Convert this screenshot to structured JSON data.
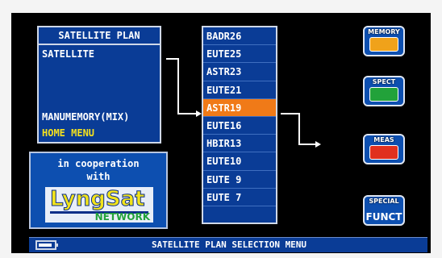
{
  "satellite_plan": {
    "title": "SATELLITE PLAN",
    "items": [
      "SATELLITE",
      "MANUMEMORY(MIX)",
      "HOME MENU"
    ]
  },
  "partner": {
    "line1": "in cooperation",
    "line2": "with",
    "logo_word": "LyngSat",
    "logo_sub": "NETWORK"
  },
  "satellite_list": {
    "items": [
      "BADR26",
      "EUTE25",
      "ASTR23",
      "EUTE21",
      "ASTR19",
      "EUTE16",
      "HBIR13",
      "EUTE10",
      "EUTE 9",
      "EUTE 7"
    ],
    "selected": "ASTR19"
  },
  "side_buttons": [
    {
      "label": "MEMORY",
      "icon": "memory-icon",
      "color": "#f0a21a"
    },
    {
      "label": "SPECT",
      "icon": "spectrum-icon",
      "color": "#22a23a"
    },
    {
      "label": "MEAS",
      "icon": "meas-icon",
      "color": "#e0301e"
    },
    {
      "label": "SPECIAL",
      "sub": "FUNCT",
      "icon": "special-icon",
      "color": "#0d4fb0"
    }
  ],
  "status_bar": {
    "text": "SATELLITE PLAN SELECTION MENU",
    "battery_icon": "battery-icon"
  },
  "colors": {
    "panel": "#0a3c96",
    "selected": "#f07a18",
    "home_menu": "#f5e11e"
  }
}
